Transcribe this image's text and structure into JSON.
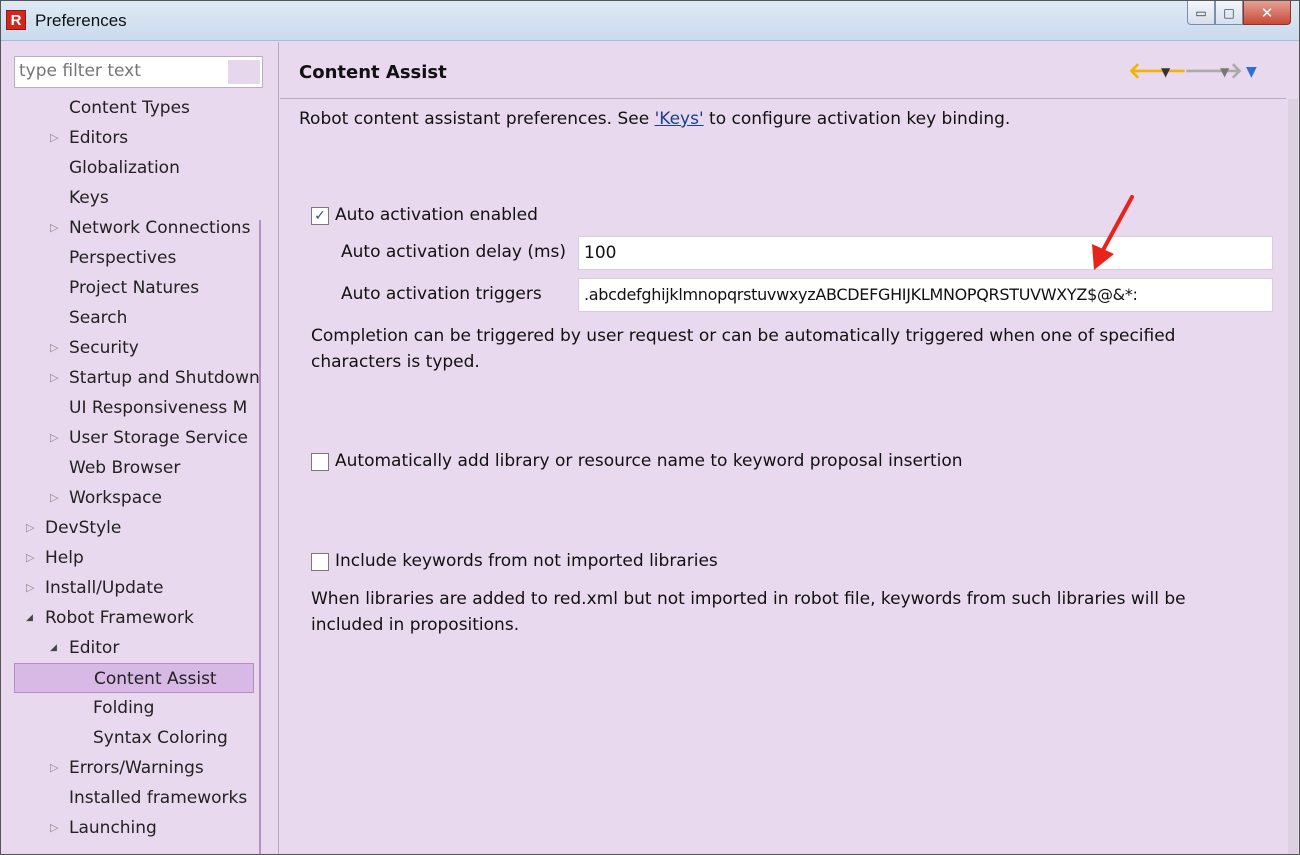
{
  "window": {
    "title": "Preferences",
    "app_icon": "R"
  },
  "filter": {
    "placeholder": "type filter text"
  },
  "tree": [
    {
      "label": "Content Types",
      "level": 1,
      "arrow": ""
    },
    {
      "label": "Editors",
      "level": 1,
      "arrow": "▷"
    },
    {
      "label": "Globalization",
      "level": 1,
      "arrow": ""
    },
    {
      "label": "Keys",
      "level": 1,
      "arrow": ""
    },
    {
      "label": "Network Connections",
      "level": 1,
      "arrow": "▷"
    },
    {
      "label": "Perspectives",
      "level": 1,
      "arrow": ""
    },
    {
      "label": "Project Natures",
      "level": 1,
      "arrow": ""
    },
    {
      "label": "Search",
      "level": 1,
      "arrow": ""
    },
    {
      "label": "Security",
      "level": 1,
      "arrow": "▷"
    },
    {
      "label": "Startup and Shutdown",
      "level": 1,
      "arrow": "▷"
    },
    {
      "label": "UI Responsiveness M",
      "level": 1,
      "arrow": ""
    },
    {
      "label": "User Storage Service",
      "level": 1,
      "arrow": "▷"
    },
    {
      "label": "Web Browser",
      "level": 1,
      "arrow": ""
    },
    {
      "label": "Workspace",
      "level": 1,
      "arrow": "▷"
    },
    {
      "label": "DevStyle",
      "level": 0,
      "arrow": "▷"
    },
    {
      "label": "Help",
      "level": 0,
      "arrow": "▷"
    },
    {
      "label": "Install/Update",
      "level": 0,
      "arrow": "▷"
    },
    {
      "label": "Robot Framework",
      "level": 0,
      "arrow": "◢"
    },
    {
      "label": "Editor",
      "level": 1,
      "arrow": "◢"
    },
    {
      "label": "Content Assist",
      "level": 2,
      "arrow": "",
      "selected": true
    },
    {
      "label": "Folding",
      "level": 2,
      "arrow": ""
    },
    {
      "label": "Syntax Coloring",
      "level": 2,
      "arrow": ""
    },
    {
      "label": "Errors/Warnings",
      "level": 1,
      "arrow": "▷"
    },
    {
      "label": "Installed frameworks",
      "level": 1,
      "arrow": ""
    },
    {
      "label": "Launching",
      "level": 1,
      "arrow": "▷"
    }
  ],
  "page": {
    "title": "Content Assist",
    "desc_before": "Robot content assistant preferences. See ",
    "desc_link": "'Keys'",
    "desc_after": " to configure activation key binding.",
    "auto_activation": {
      "label": "Auto activation enabled",
      "checked": true,
      "delay_label": "Auto activation delay (ms)",
      "delay_value": "100",
      "triggers_label": "Auto activation triggers",
      "triggers_value": ".abcdefghijklmnopqrstuvwxyzABCDEFGHIJKLMNOPQRSTUVWXYZ$@&*:",
      "help_line1": "Completion can be triggered by user request or can be automatically triggered when one of specified",
      "help_line2": "characters is typed."
    },
    "add_library": {
      "label": "Automatically add library or resource name to keyword proposal insertion",
      "checked": false
    },
    "include_keywords": {
      "label": "Include keywords from not imported libraries",
      "checked": false,
      "help_line1": "When libraries are added to red.xml but not imported in robot file, keywords from such libraries will be",
      "help_line2": "included in propositions."
    }
  },
  "colors": {
    "background": "#e9d9ee",
    "selection": "#d8b8e4",
    "annotation_arrow": "#e8231a",
    "back_arrow": "#f0b400"
  }
}
